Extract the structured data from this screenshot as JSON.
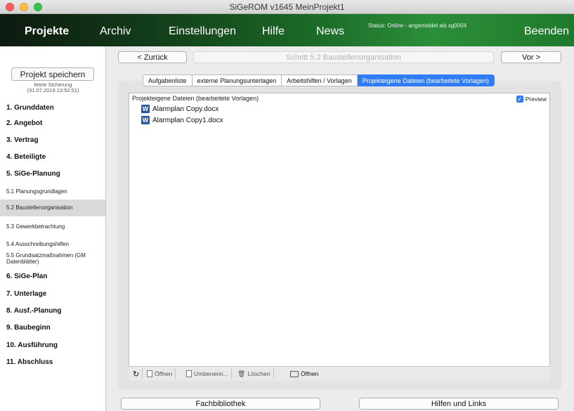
{
  "window": {
    "title": "SiGeROM  v1645   MeinProjekt1"
  },
  "menu": {
    "items": [
      "Projekte",
      "Archiv",
      "Einstellungen",
      "Hilfe",
      "News",
      "Beenden"
    ],
    "status": "Status: Online - angemeldet als sg0004"
  },
  "sidebar": {
    "save_button": "Projekt speichern",
    "last_save_label": "letzte Sicherung",
    "last_save_time": "(31.07.2019 13:52:51)",
    "items": [
      "1.  Grunddaten",
      "2.  Angebot",
      "3.  Vertrag",
      "4.  Beteiligte",
      "5.  SiGe-Planung",
      "5.1 Planungsgrundlagen",
      "5.2 Baustellenorganisation",
      "5.3 Gewerkbetrachtung",
      "5.4 Ausschreibungshilfen",
      "5.5 Grundsatzmaßnahmen (GM",
      "Datenblätter)",
      "6.  SiGe-Plan",
      "7.  Unterlage",
      "8.  Ausf.-Planung",
      "9.  Baubeginn",
      "10. Ausführung",
      "11. Abschluss"
    ]
  },
  "step": {
    "back": "< Zurück",
    "title": "Schritt 5.2  Baustellenorganisation",
    "forward": "Vor >"
  },
  "tabs": [
    "Aufgabenliste",
    "externe Planungsunterlagen",
    "Arbeitshilfen / Vorlagen",
    "Projekteigene Dateien (bearbeitete Vorlagen)"
  ],
  "panel": {
    "title": "Projekteigene Dateien (bearbeitete Vorlagen)",
    "preview_label": "Preview",
    "files": [
      "Alarmplan Copy.docx",
      "Alarmplan Copy1.docx"
    ]
  },
  "toolbar": {
    "open": "Öffnen",
    "rename": "Umbenenn...",
    "delete": "Löschen",
    "open_folder": "Öffnen"
  },
  "footer": {
    "library": "Fachbibliothek",
    "help": "Hilfen und Links"
  },
  "colors": {
    "accent": "#2f7df6",
    "menubar_dark": "#0e1a10",
    "menubar_green": "#2b8e39",
    "word_blue": "#2b579a"
  }
}
